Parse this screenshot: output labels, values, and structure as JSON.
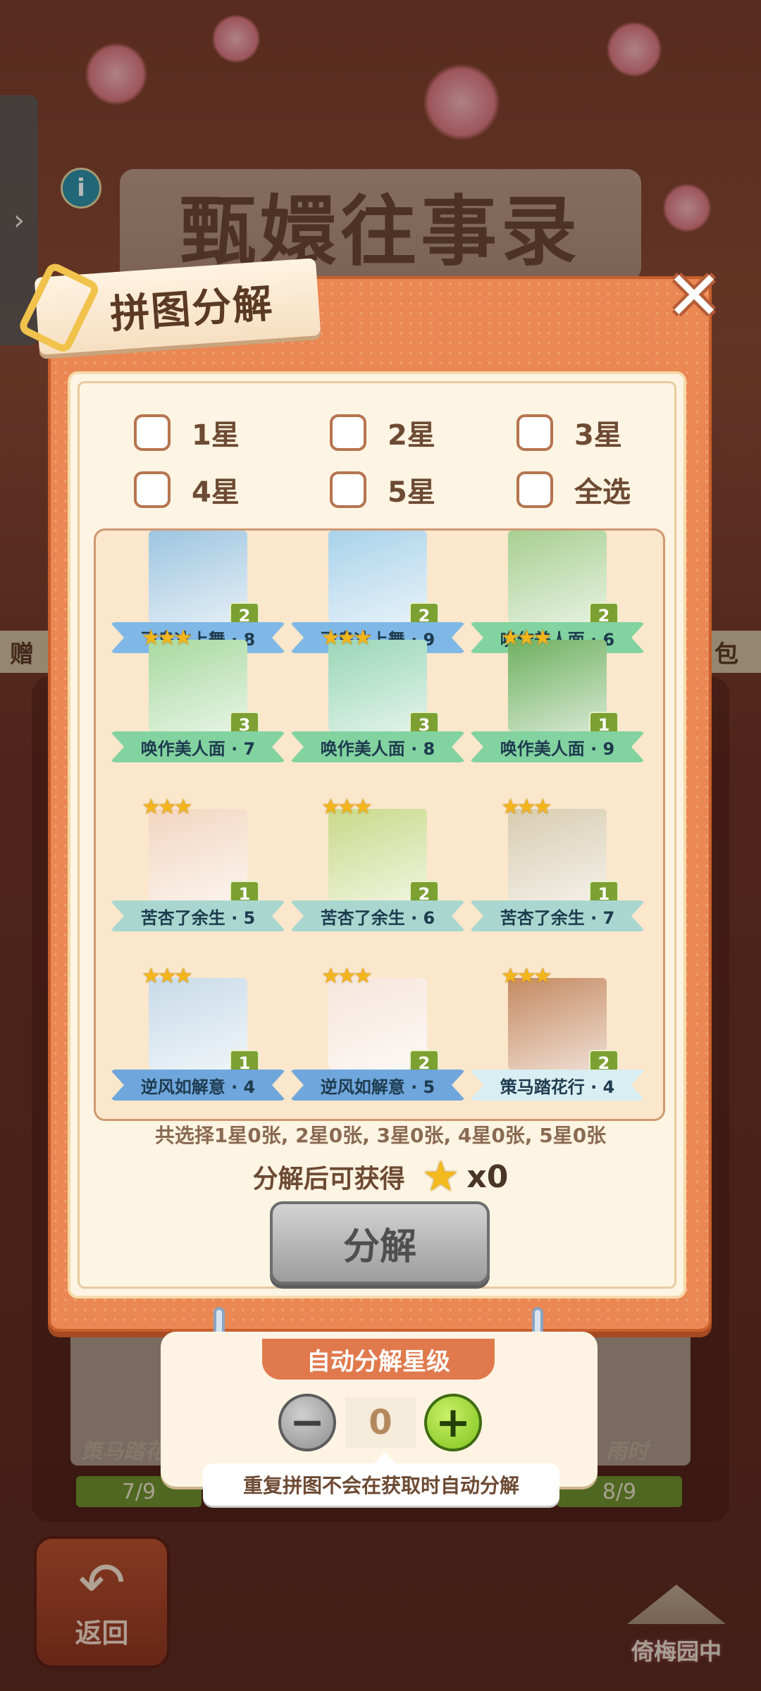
{
  "background": {
    "banner_text": "甄嬛往事录",
    "strip_left": "赠",
    "strip_right": "包",
    "bg_cards": [
      {
        "label": "策马踏花",
        "progress": "7/9"
      },
      {
        "label": "雨时",
        "progress": "8/9"
      }
    ],
    "back_label": "返回",
    "garden_label": "倚梅园中"
  },
  "modal": {
    "title": "拼图分解",
    "close_icon": "close-icon",
    "filters": [
      {
        "label": "1星",
        "checked": false
      },
      {
        "label": "2星",
        "checked": false
      },
      {
        "label": "3星",
        "checked": false
      },
      {
        "label": "4星",
        "checked": false
      },
      {
        "label": "5星",
        "checked": false
      },
      {
        "label": "全选",
        "checked": false
      }
    ],
    "pieces": [
      {
        "name": "飞鸟冰上舞 · 8",
        "count": "2",
        "stars": "",
        "ribbon": "#7fb8e6",
        "img": "#9ec5e0"
      },
      {
        "name": "飞鸟冰上舞 · 9",
        "count": "2",
        "stars": "",
        "ribbon": "#7fb8e6",
        "img": "#a9d2ea"
      },
      {
        "name": "唤作美人面 · 6",
        "count": "2",
        "stars": "",
        "ribbon": "#82d3a0",
        "img": "#a7cf92"
      },
      {
        "name": "唤作美人面 · 7",
        "count": "3",
        "stars": "★★★",
        "ribbon": "#82d3a0",
        "img": "#a8d9a0"
      },
      {
        "name": "唤作美人面 · 8",
        "count": "3",
        "stars": "★★★",
        "ribbon": "#82d3a0",
        "img": "#9ad6b8"
      },
      {
        "name": "唤作美人面 · 9",
        "count": "1",
        "stars": "★★★",
        "ribbon": "#82d3a0",
        "img": "#6fb060"
      },
      {
        "name": "苦杏了余生 · 5",
        "count": "1",
        "stars": "★★★",
        "ribbon": "#a9d7d0",
        "img": "#f3d6c0"
      },
      {
        "name": "苦杏了余生 · 6",
        "count": "2",
        "stars": "★★★",
        "ribbon": "#a9d7d0",
        "img": "#c9d98a"
      },
      {
        "name": "苦杏了余生 · 7",
        "count": "1",
        "stars": "★★★",
        "ribbon": "#a9d7d0",
        "img": "#d8ccb0"
      },
      {
        "name": "逆风如解意 · 4",
        "count": "1",
        "stars": "★★★",
        "ribbon": "#6fa6dc",
        "img": "#c8dbe8"
      },
      {
        "name": "逆风如解意 · 5",
        "count": "2",
        "stars": "★★★",
        "ribbon": "#6fa6dc",
        "img": "#f6e6dc"
      },
      {
        "name": "策马踏花行 · 4",
        "count": "2",
        "stars": "★★★",
        "ribbon": "#d9eef2",
        "img": "#c58a62"
      }
    ],
    "summary": "共选择1星0张, 2星0张, 3星0张, 4星0张, 5星0张",
    "reward_label": "分解后可获得",
    "reward_qty": "x0",
    "decompose_label": "分解"
  },
  "auto_panel": {
    "title": "自动分解星级",
    "value": "0",
    "note": "重复拼图不会在获取时自动分解"
  },
  "colors": {
    "modal_orange": "#ea8752",
    "accent_green": "#7fc21a",
    "title_brown": "#5b3a25"
  }
}
